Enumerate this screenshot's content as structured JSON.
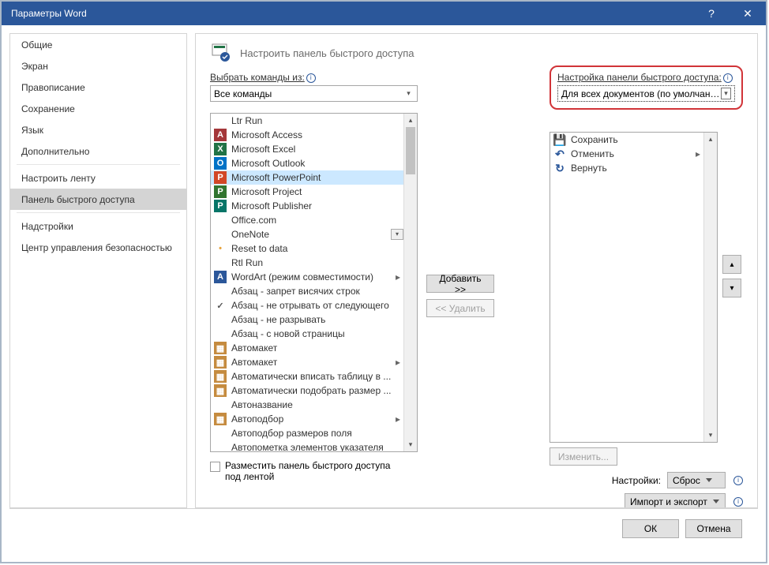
{
  "titlebar": {
    "title": "Параметры Word",
    "help": "?",
    "close": "✕"
  },
  "sidebar": {
    "groups": [
      [
        "Общие",
        "Экран",
        "Правописание",
        "Сохранение",
        "Язык",
        "Дополнительно"
      ],
      [
        "Настроить ленту",
        "Панель быстрого доступа"
      ],
      [
        "Надстройки",
        "Центр управления безопасностью"
      ]
    ],
    "selected": "Панель быстрого доступа"
  },
  "header": {
    "title": "Настроить панель быстрого доступа"
  },
  "left": {
    "label": "Выбрать команды из:",
    "dropdown": "Все команды",
    "commands": [
      {
        "txt": "Ltr Run",
        "icon": "",
        "bg": ""
      },
      {
        "txt": "Microsoft Access",
        "icon": "A",
        "bg": "#a4373a"
      },
      {
        "txt": "Microsoft Excel",
        "icon": "X",
        "bg": "#217346"
      },
      {
        "txt": "Microsoft Outlook",
        "icon": "O",
        "bg": "#0072c6"
      },
      {
        "txt": "Microsoft PowerPoint",
        "icon": "P",
        "bg": "#d24726",
        "selected": true
      },
      {
        "txt": "Microsoft Project",
        "icon": "P",
        "bg": "#31752f"
      },
      {
        "txt": "Microsoft Publisher",
        "icon": "P",
        "bg": "#077568"
      },
      {
        "txt": "Office.com",
        "icon": "",
        "bg": ""
      },
      {
        "txt": "OneNote",
        "icon": "",
        "bg": "",
        "submenu": true
      },
      {
        "txt": "Reset to data",
        "icon": "•",
        "bg": "",
        "dotcolor": "#e8a33d"
      },
      {
        "txt": "Rtl Run",
        "icon": "",
        "bg": ""
      },
      {
        "txt": "WordArt (режим совместимости)",
        "icon": "A",
        "bg": "#2b579a",
        "chev": true
      },
      {
        "txt": "Абзац - запрет висячих строк",
        "icon": "",
        "bg": ""
      },
      {
        "txt": "Абзац - не отрывать от следующего",
        "icon": "✓",
        "bg": ""
      },
      {
        "txt": "Абзац - не разрывать",
        "icon": "",
        "bg": ""
      },
      {
        "txt": "Абзац - с новой страницы",
        "icon": "",
        "bg": ""
      },
      {
        "txt": "Автомакет",
        "icon": "▦",
        "bg": "#c58b3f"
      },
      {
        "txt": "Автомакет",
        "icon": "▦",
        "bg": "#c58b3f",
        "chev": true
      },
      {
        "txt": "Автоматически вписать таблицу в ...",
        "icon": "▦",
        "bg": "#c58b3f"
      },
      {
        "txt": "Автоматически подобрать размер ...",
        "icon": "▦",
        "bg": "#c58b3f"
      },
      {
        "txt": "Автоназвание",
        "icon": "",
        "bg": ""
      },
      {
        "txt": "Автоподбор",
        "icon": "▦",
        "bg": "#c58b3f",
        "chev": true
      },
      {
        "txt": "Автоподбор размеров поля",
        "icon": "",
        "bg": ""
      },
      {
        "txt": "Автопометка элементов указателя",
        "icon": "",
        "bg": ""
      }
    ],
    "checkbox": "Разместить панель быстрого доступа под лентой"
  },
  "mid": {
    "add": "Добавить >>",
    "remove": "<< Удалить"
  },
  "right": {
    "label": "Настройка панели быстрого доступа:",
    "dropdown": "Для всех документов (по умолчани...",
    "items": [
      {
        "txt": "Сохранить",
        "icon": "💾",
        "color": "#2b579a"
      },
      {
        "txt": "Отменить",
        "icon": "↶",
        "color": "#2b579a",
        "chev": true
      },
      {
        "txt": "Вернуть",
        "icon": "↻",
        "color": "#2b579a"
      }
    ],
    "modify": "Изменить...",
    "settingsLabel": "Настройки:",
    "reset": "Сброс",
    "importexport": "Импорт и экспорт"
  },
  "footer": {
    "ok": "ОК",
    "cancel": "Отмена"
  }
}
